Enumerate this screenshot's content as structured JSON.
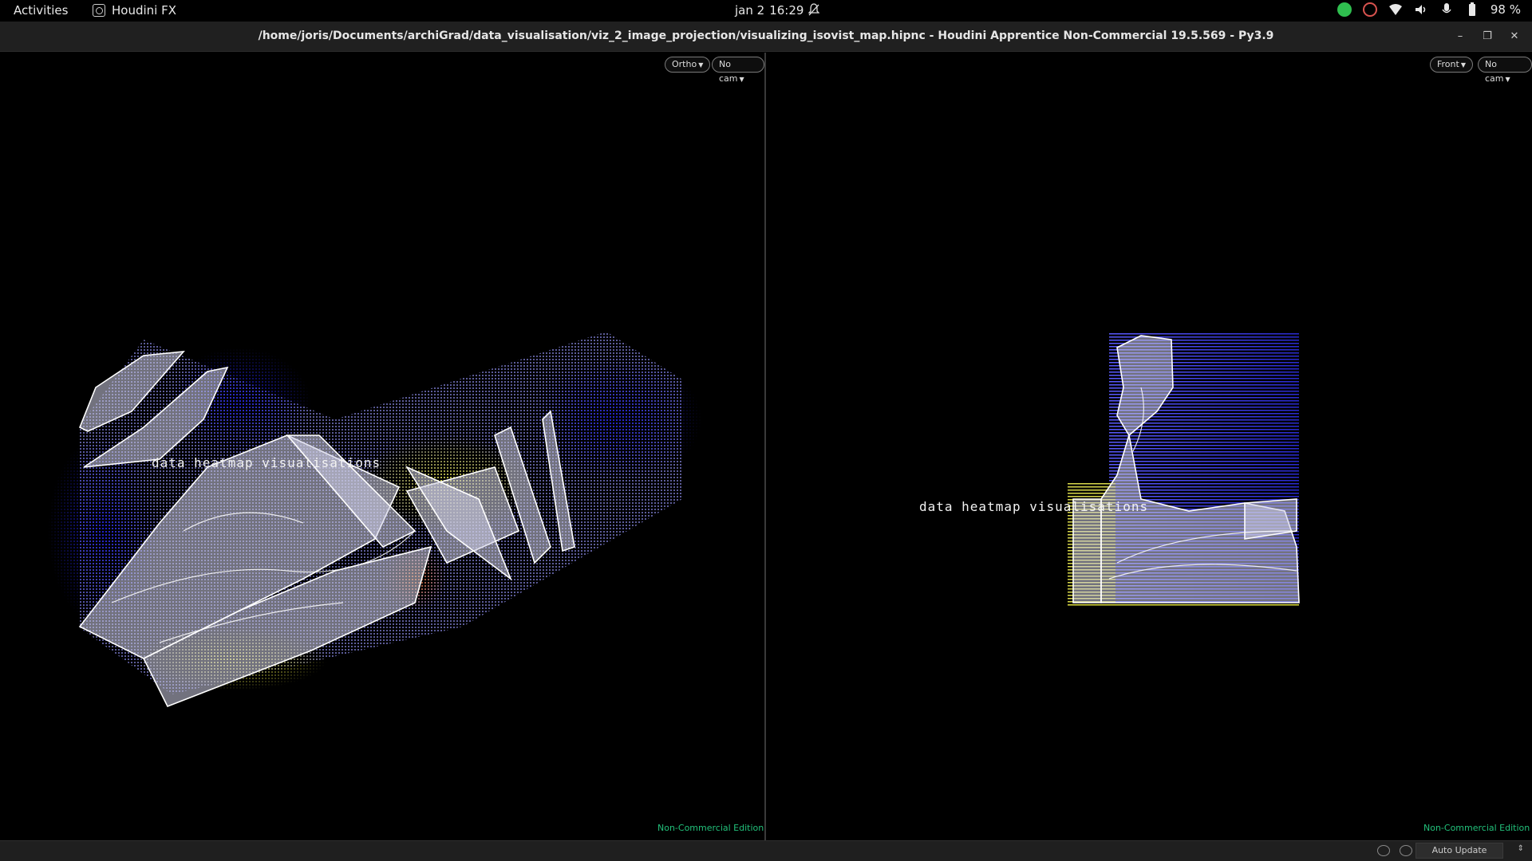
{
  "topbar": {
    "activities": "Activities",
    "app_name": "Houdini FX",
    "date": "jan 2",
    "time": "16:29",
    "battery": "98 %"
  },
  "window": {
    "title": "/home/joris/Documents/archiGrad/data_visualisation/viz_2_image_projection/visualizing_isovist_map.hipnc - Houdini Apprentice Non-Commercial 19.5.569 - Py3.9"
  },
  "viewports": {
    "left": {
      "view_menu": "Ortho",
      "camera_menu": "No cam",
      "label": "data heatmap visualisations",
      "edition": "Non-Commercial Edition"
    },
    "right": {
      "view_menu": "Front",
      "camera_menu": "No cam",
      "label": "data heatmap visualisations",
      "edition": "Non-Commercial Edition"
    }
  },
  "statusbar": {
    "update_mode": "Auto Update"
  },
  "colors": {
    "heat_blue": "#2b2bd8",
    "heat_yellow": "#d8d83a",
    "heat_orange": "#d86a1a",
    "edition_green": "#22c07a"
  }
}
